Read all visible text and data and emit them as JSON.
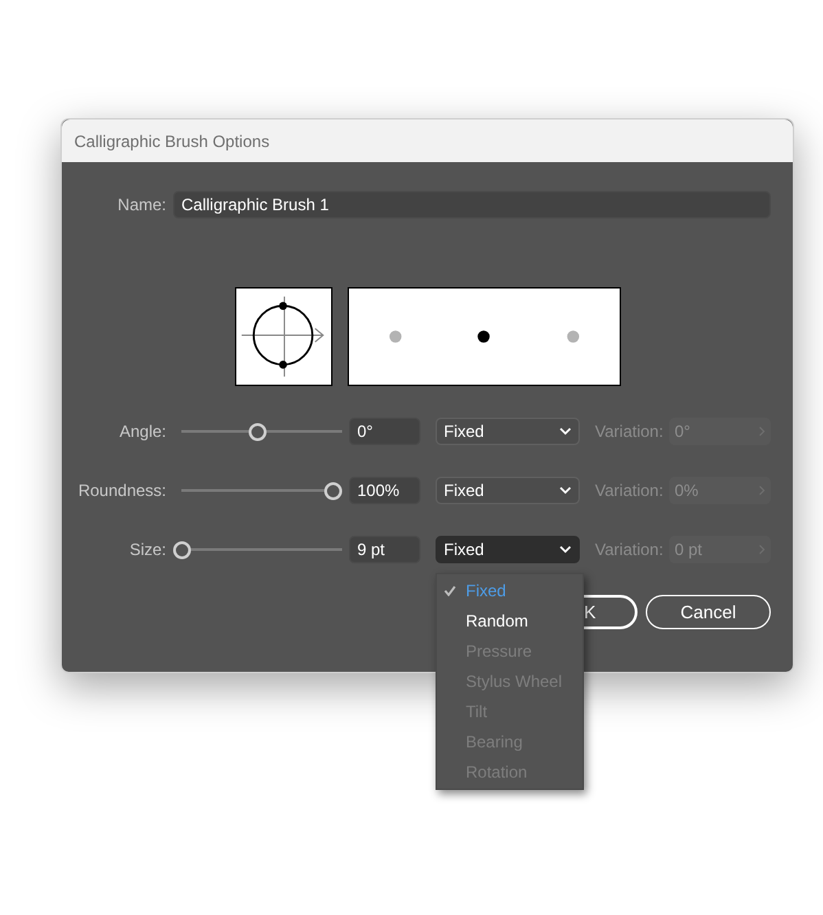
{
  "window": {
    "title": "Calligraphic Brush Options"
  },
  "name_field": {
    "label": "Name:",
    "value": "Calligraphic Brush 1"
  },
  "settings": [
    {
      "label": "Angle:",
      "level": 0.5,
      "value": "0°",
      "mode": "Fixed",
      "open": false,
      "variation_label": "Variation:",
      "variation": "0°",
      "variation_disabled": true
    },
    {
      "label": "Roundness:",
      "level": 1,
      "value": "100%",
      "mode": "Fixed",
      "open": false,
      "variation_label": "Variation:",
      "variation": "0%",
      "variation_disabled": true
    },
    {
      "label": "Size:",
      "level": 0,
      "value": "9 pt",
      "mode": "Fixed",
      "open": true,
      "variation_label": "Variation:",
      "variation": "0 pt",
      "variation_disabled": true
    }
  ],
  "menu": {
    "items": [
      {
        "label": "Fixed",
        "selected": true,
        "disabled": false
      },
      {
        "label": "Random",
        "selected": false,
        "disabled": false
      },
      {
        "label": "Pressure",
        "selected": false,
        "disabled": true
      },
      {
        "label": "Stylus Wheel",
        "selected": false,
        "disabled": true
      },
      {
        "label": "Tilt",
        "selected": false,
        "disabled": true
      },
      {
        "label": "Bearing",
        "selected": false,
        "disabled": true
      },
      {
        "label": "Rotation",
        "selected": false,
        "disabled": true
      }
    ]
  },
  "buttons": [
    {
      "label": "K",
      "kind": "primary"
    },
    {
      "label": "Cancel",
      "kind": "secondary"
    }
  ]
}
